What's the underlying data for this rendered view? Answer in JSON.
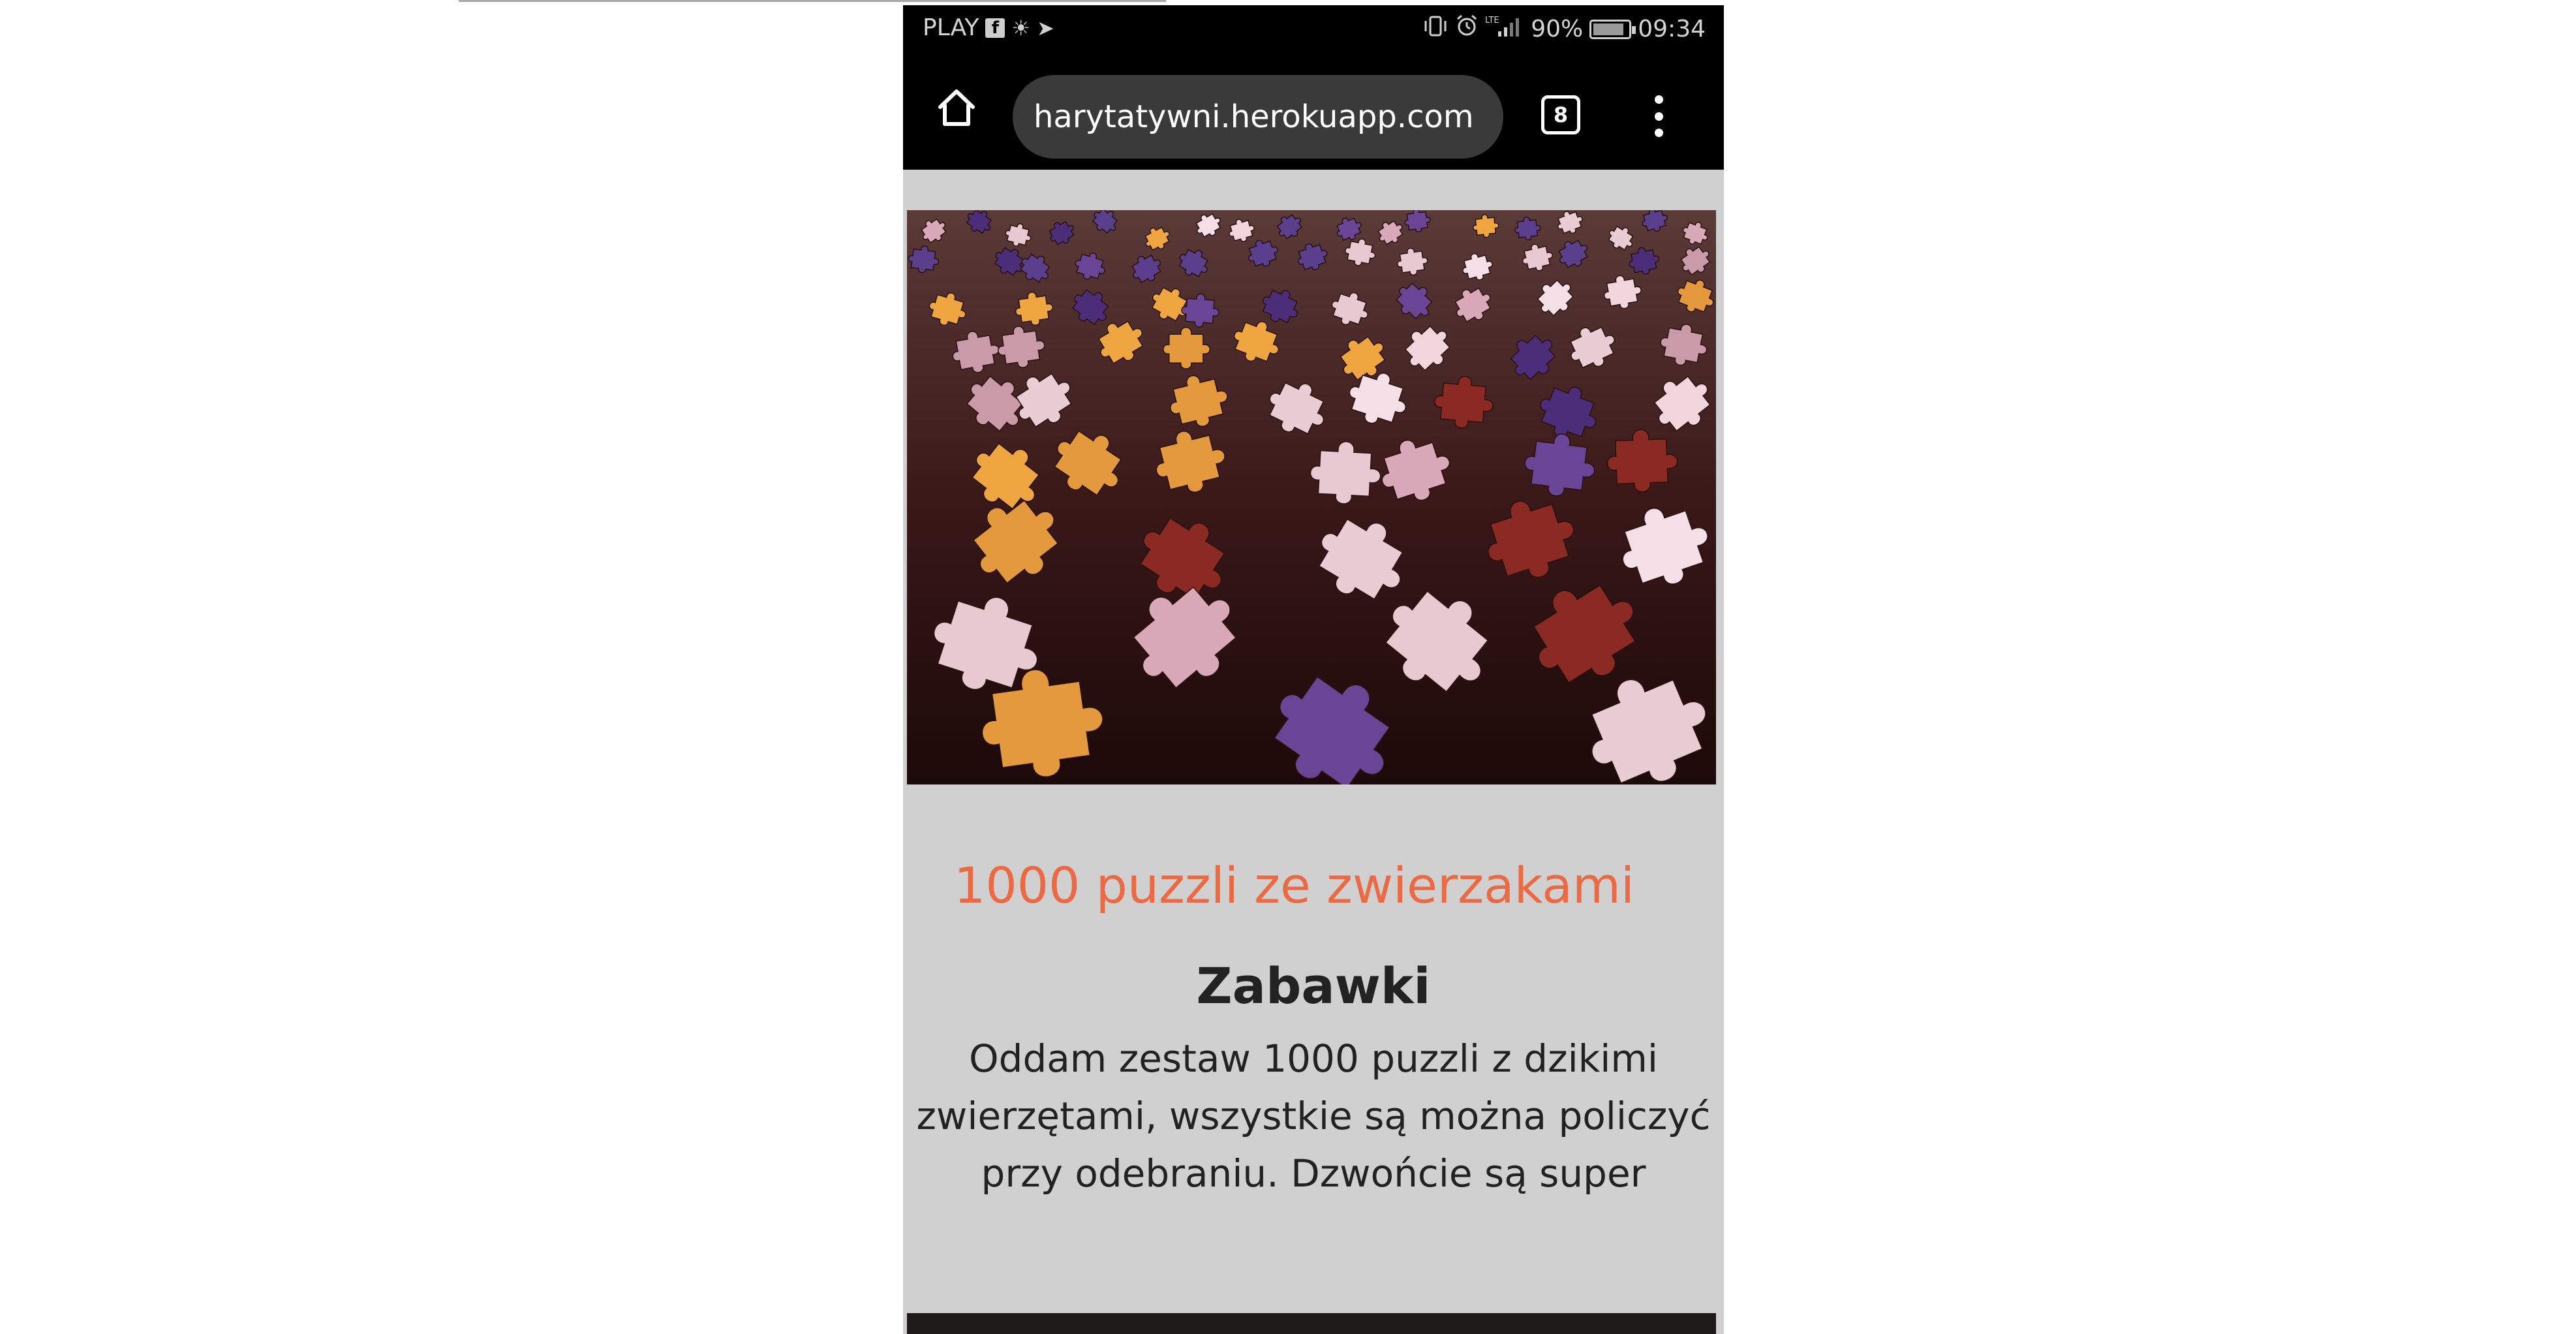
{
  "status_bar": {
    "carrier": "PLAY",
    "left_icons": [
      "facebook-icon",
      "brightness-icon",
      "send-icon"
    ],
    "right_icons": [
      "vibrate-icon",
      "alarm-icon",
      "lte-signal-icon"
    ],
    "lte_label": "LTE",
    "battery_percent": "90%",
    "battery_level": 0.9,
    "time": "09:34"
  },
  "browser": {
    "home_icon": "home-icon",
    "url": "harytatywni.herokuapp.com",
    "tab_count": "8",
    "menu_icon": "more-vert-icon"
  },
  "listing": {
    "image": "jigsaw-puzzle-pieces-photo",
    "title": "1000 puzzli ze zwierzakami",
    "category": "Zabawki",
    "description": "Oddam zestaw 1000 puzzli z dzikimi zwierzętami, wszystkie są można policzyć przy odebraniu. Dzwońcie są super"
  },
  "colors": {
    "title": "#ec6a43",
    "page_background": "#d0d0d0",
    "toolbar": "#000000",
    "urlbar": "#3a3a3a"
  }
}
